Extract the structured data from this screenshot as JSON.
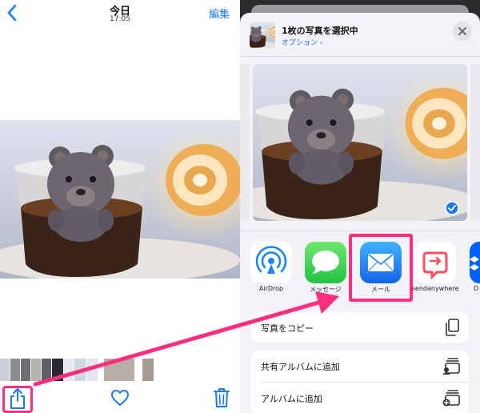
{
  "photos_app": {
    "nav": {
      "title": "今日",
      "time": "17:05",
      "edit_label": "編集"
    },
    "toolbar": {
      "share": "share-icon",
      "favorite": "heart-icon",
      "delete": "trash-icon"
    }
  },
  "share_sheet": {
    "header": {
      "title": "1枚の写真を選択中",
      "options_label": "オプション ›"
    },
    "apps": [
      {
        "label": "AirDrop",
        "icon": "airdrop-icon"
      },
      {
        "label": "メッセージ",
        "icon": "messages-icon"
      },
      {
        "label": "メール",
        "icon": "mail-icon"
      },
      {
        "label": "sendanywhere",
        "icon": "sendanywhere-icon"
      },
      {
        "label": "D",
        "icon": "dropbox-icon"
      }
    ],
    "actions": [
      {
        "label": "写真をコピー",
        "icon": "copy-icon"
      },
      {
        "label": "共有アルバムに追加",
        "icon": "shared-album-icon"
      },
      {
        "label": "アルバムに追加",
        "icon": "add-album-icon"
      }
    ]
  },
  "colors": {
    "accent": "#1a7cf5",
    "highlight": "#ff2e7e",
    "messages_green": "#34c759",
    "mail_blue": "#1a86f5",
    "sendanywhere_red": "#ff4d5e",
    "sheet_bg": "#f2f2f7"
  }
}
